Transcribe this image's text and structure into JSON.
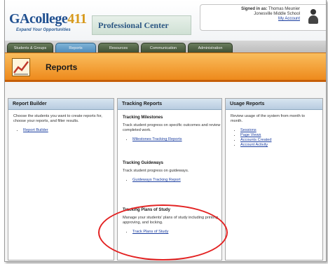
{
  "header": {
    "logo_main": "GAcollege",
    "logo_num": "411",
    "tagline": "Expand Your Opportunities",
    "product": "Professional Center",
    "signin": {
      "label": "Signed in as:",
      "name": "Thomas Meunier",
      "school": "Jonesville Middle School",
      "account_link": "My Account"
    }
  },
  "tabs": [
    {
      "label": "Students & Groups",
      "active": false
    },
    {
      "label": "Reports",
      "active": true
    },
    {
      "label": "Resources",
      "active": false
    },
    {
      "label": "Communication",
      "active": false
    },
    {
      "label": "Administration",
      "active": false
    }
  ],
  "banner": {
    "title": "Reports"
  },
  "columns": {
    "builder": {
      "title": "Report Builder",
      "description": "Choose the students you want to create reports for, choose your reports, and filter results.",
      "links": [
        "Report Builder"
      ]
    },
    "tracking": {
      "title": "Tracking Reports",
      "sections": [
        {
          "heading": "Tracking Milestones",
          "description": "Track student progress on specific outcomes and review completed work.",
          "link": "Milestones Tracking Reports"
        },
        {
          "heading": "Tracking Guideways",
          "description": "Track student progress on guideways.",
          "link": "Guideways Tracking Report"
        },
        {
          "heading": "Tracking Plans of Study",
          "description": "Manage your students' plans of study including printing, approving, and locking.",
          "link": "Track Plans of Study"
        }
      ]
    },
    "usage": {
      "title": "Usage Reports",
      "description": "Review usage of the system from month to month.",
      "links": [
        "Sessions",
        "Page Views",
        "Accounts Created",
        "Account Activity"
      ]
    }
  },
  "colors": {
    "accent_orange": "#ee8a1c",
    "active_tab": "#4f8cbb",
    "tab": "#3f5035",
    "highlight_circle": "#e32222"
  }
}
